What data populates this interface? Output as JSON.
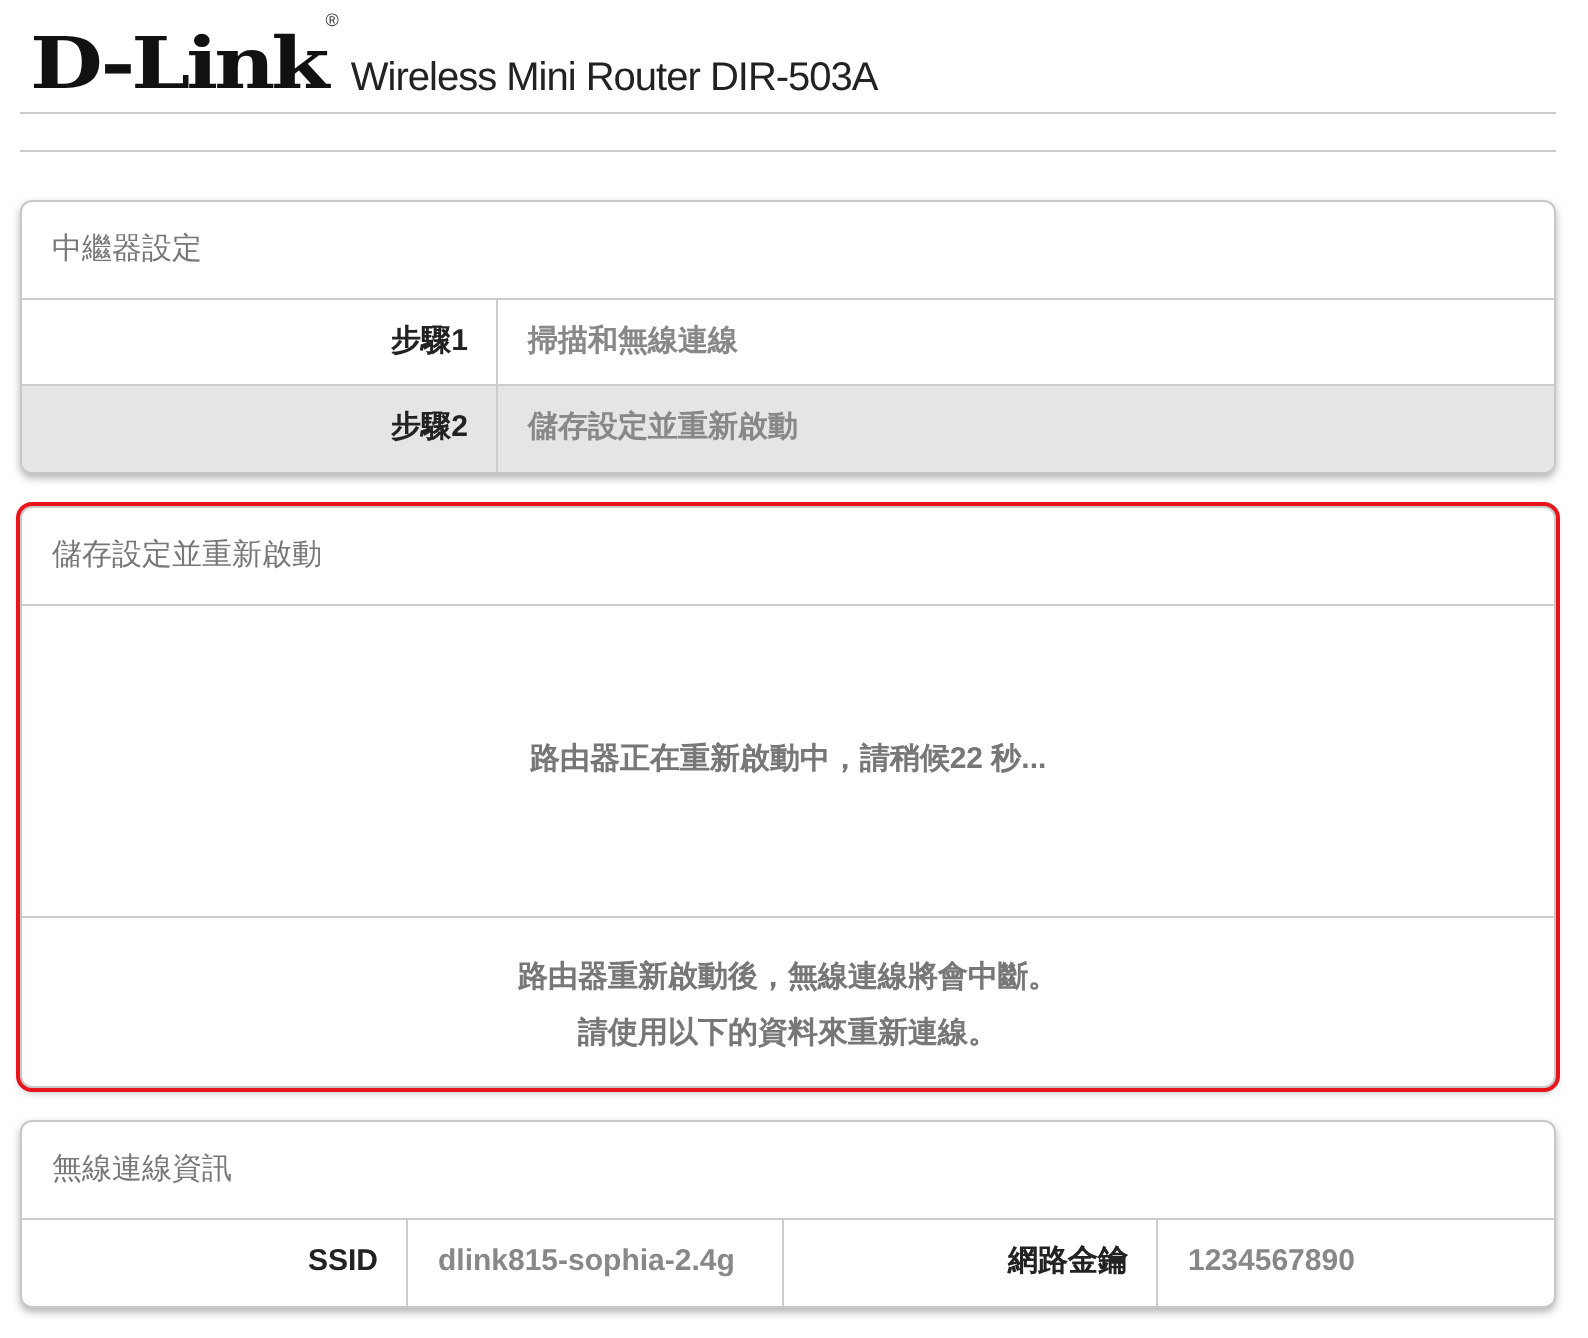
{
  "header": {
    "logo": "D-Link",
    "registered": "®",
    "product": "Wireless Mini Router DIR-503A"
  },
  "steps_panel": {
    "title": "中繼器設定",
    "steps": [
      {
        "label": "步驟1",
        "text": "掃描和無線連線",
        "selected": false
      },
      {
        "label": "步驟2",
        "text": "儲存設定並重新啟動",
        "selected": true
      }
    ]
  },
  "reboot_panel": {
    "title": "儲存設定並重新啟動",
    "highlighted": true,
    "message": "路由器正在重新啟動中，請稍候22 秒...",
    "notes": [
      "路由器重新啟動後，無線連線將會中斷。",
      "請使用以下的資料來重新連線。"
    ]
  },
  "wireless_panel": {
    "title": "無線連線資訊",
    "fields": [
      {
        "label": "SSID",
        "value": "dlink815-sophia-2.4g"
      },
      {
        "label": "網路金鑰",
        "value": "1234567890"
      }
    ]
  }
}
